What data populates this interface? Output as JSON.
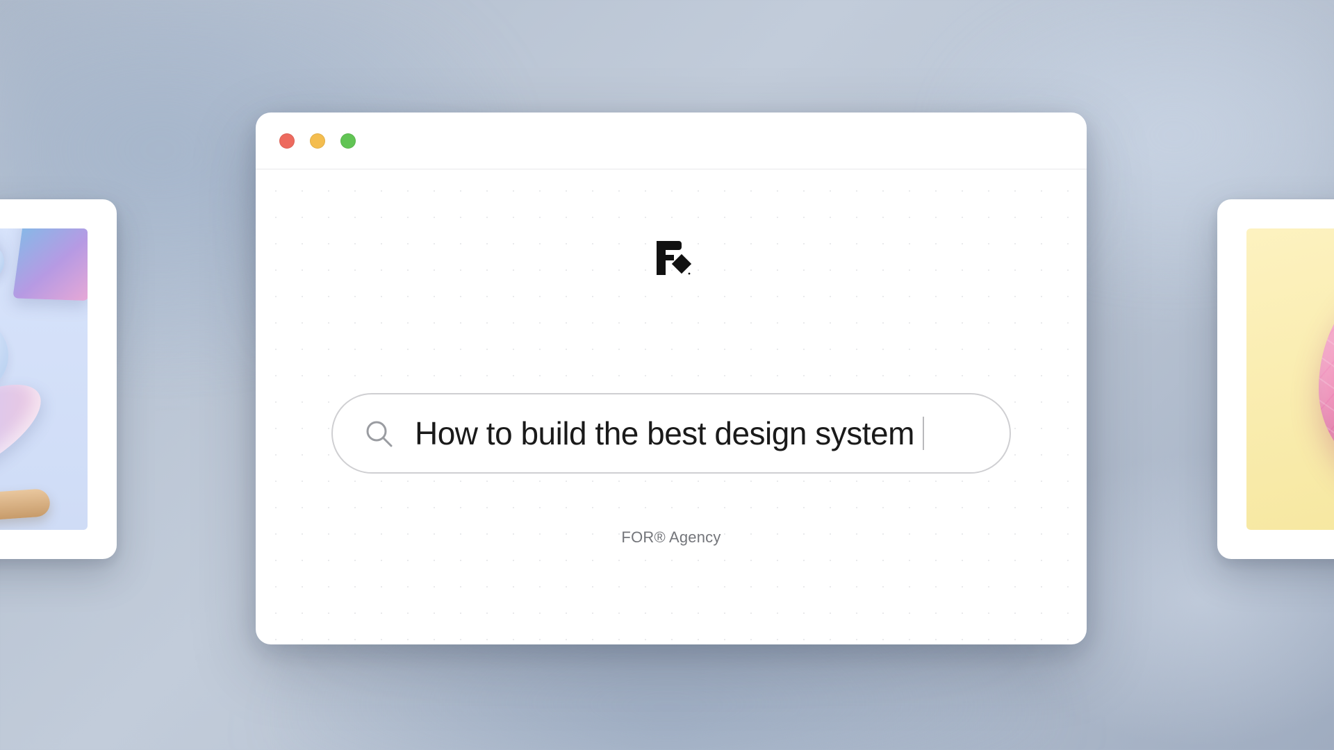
{
  "window": {
    "traffic_lights": {
      "close_color": "#ed6a5e",
      "minimize_color": "#f4bd4f",
      "zoom_color": "#61c454"
    }
  },
  "logo": {
    "name": "for-agency-logo"
  },
  "search": {
    "icon": "search-icon",
    "query": "How to build the best design system"
  },
  "footer": {
    "agency_label": "FOR® Agency"
  },
  "side_previews": {
    "left_alt": "3d-pastel-shapes-artwork",
    "right_alt": "low-poly-brain-artwork"
  }
}
